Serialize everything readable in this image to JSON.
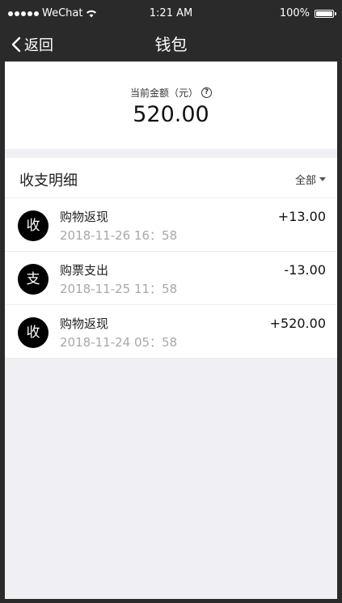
{
  "status_bar": {
    "carrier": "WeChat",
    "time": "1:21 AM",
    "battery": "100%"
  },
  "nav": {
    "back_label": "返回",
    "title": "钱包"
  },
  "balance": {
    "label": "当前金额（元）",
    "help_glyph": "?",
    "amount": "520.00"
  },
  "details": {
    "title": "收支明细",
    "filter_label": "全部"
  },
  "transactions": [
    {
      "badge": "收",
      "name": "购物返现",
      "time": "2018-11-26 16：58",
      "amount": "+13.00"
    },
    {
      "badge": "支",
      "name": "购票支出",
      "time": "2018-11-25 11：58",
      "amount": "-13.00"
    },
    {
      "badge": "收",
      "name": "购物返现",
      "time": "2018-11-24 05：58",
      "amount": "+520.00"
    }
  ],
  "colors": {
    "chrome": "#2a2a2a",
    "background": "#efeff4",
    "card": "#ffffff",
    "badge": "#000000",
    "secondary_text": "#a8a8a8"
  }
}
